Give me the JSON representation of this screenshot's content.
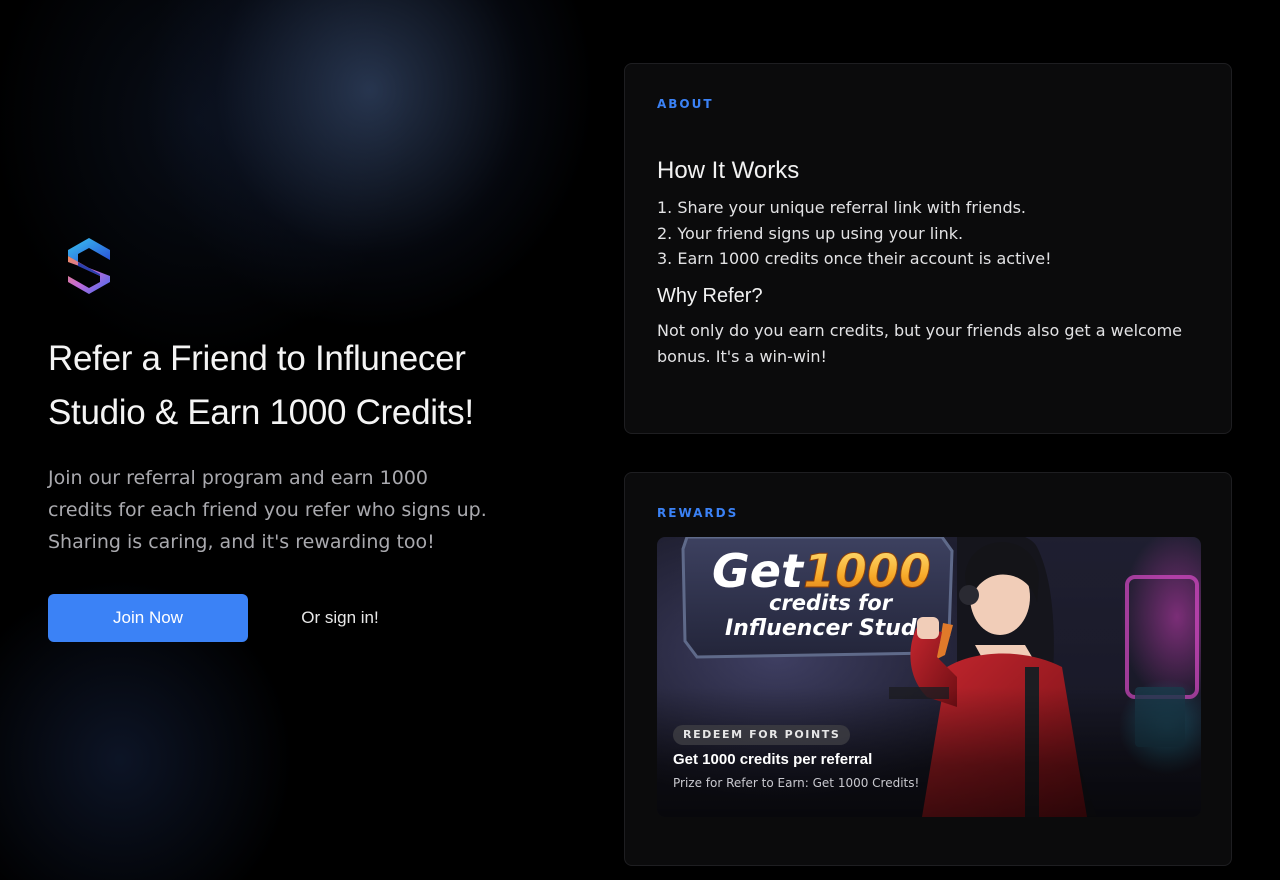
{
  "hero": {
    "logo_icon": "influencer-studio-s-logo",
    "title": "Refer a Friend to Influnecer Studio & Earn 1000 Credits!",
    "description": "Join our referral program and earn 1000 credits for each friend you refer who signs up. Sharing is caring, and it's rewarding too!",
    "join_label": "Join Now",
    "signin_label": "Or sign in!"
  },
  "about": {
    "eyebrow": "ABOUT",
    "how_heading": "How It Works",
    "steps": [
      "1. Share your unique referral link with friends.",
      "2. Your friend signs up using your link.",
      "3. Earn 1000 credits once their account is active!"
    ],
    "why_heading": "Why Refer?",
    "why_text": "Not only do you earn credits, but your friends also get a welcome bonus. It's a win-win!"
  },
  "rewards": {
    "eyebrow": "REWARDS",
    "banner": {
      "headline_get": "Get",
      "headline_amount": "1000",
      "headline_line2": "credits for",
      "headline_line3": "Influencer Studio",
      "badge": "REDEEM FOR POINTS",
      "title": "Get 1000 credits per referral",
      "subtitle": "Prize for Refer to Earn: Get 1000 Credits!"
    }
  },
  "colors": {
    "accent": "#3b82f6",
    "background": "#000000",
    "card": "#0b0b0c"
  }
}
